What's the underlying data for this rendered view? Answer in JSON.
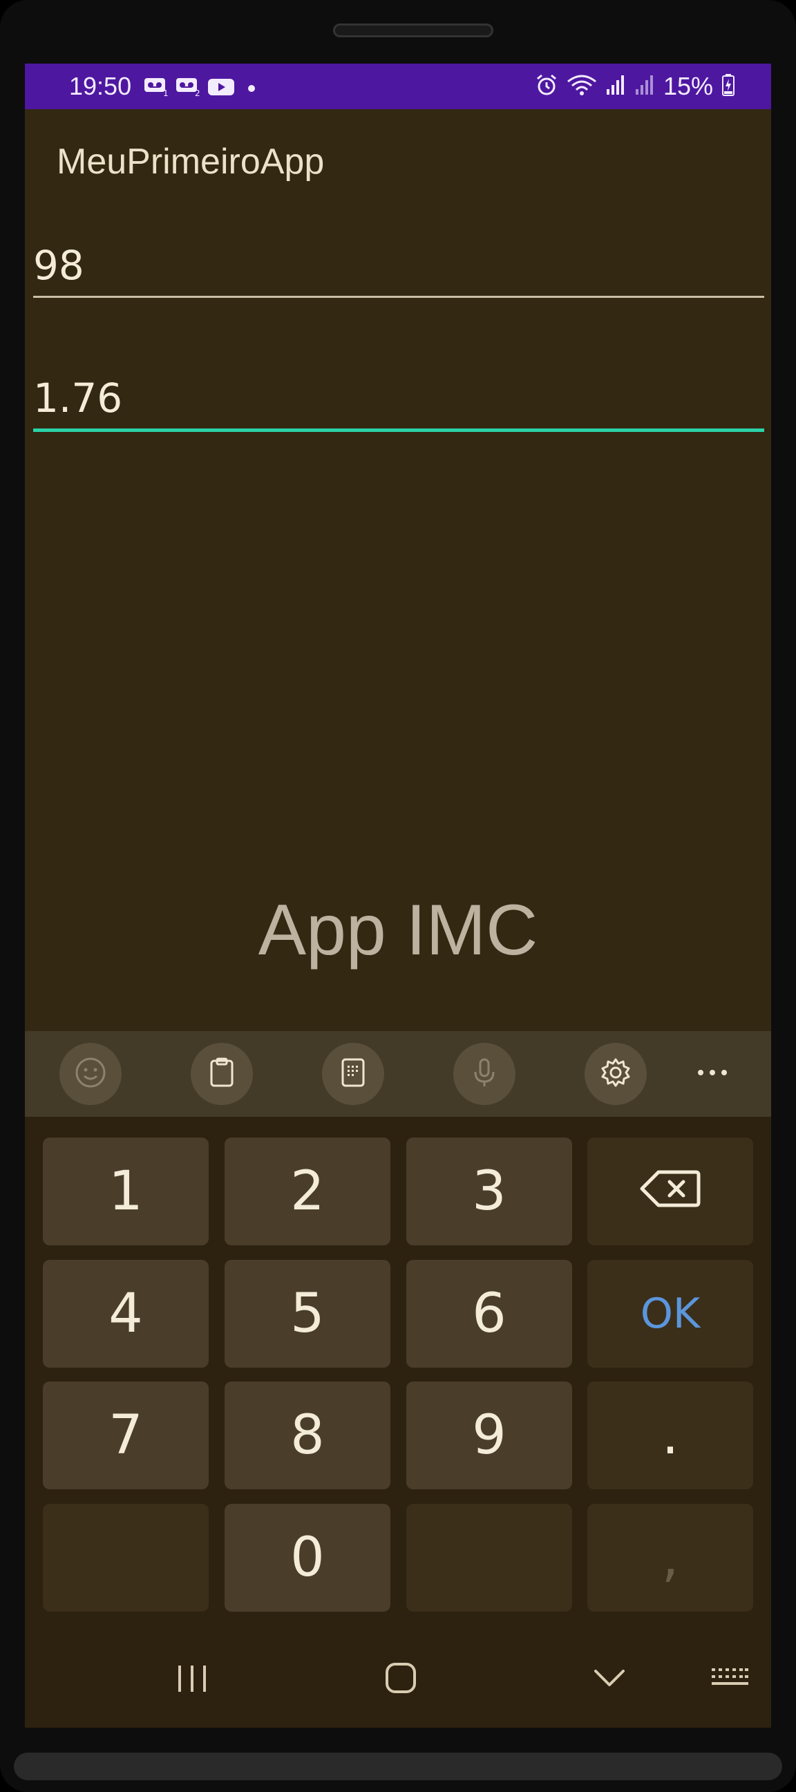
{
  "status_bar": {
    "time": "19:50",
    "battery_percent": "15%",
    "left_icons": [
      "voicemail-1-icon",
      "voicemail-2-icon",
      "youtube-icon",
      "dot-icon"
    ],
    "right_icons": [
      "alarm-icon",
      "wifi-icon",
      "signal-1-icon",
      "signal-2-icon",
      "battery-charging-icon"
    ]
  },
  "app": {
    "title": "MeuPrimeiroApp",
    "label": "App IMC"
  },
  "fields": {
    "weight": {
      "value": "98"
    },
    "height": {
      "value": "1.76",
      "focused": true
    }
  },
  "keyboard": {
    "toolbar": [
      "emoji-icon",
      "clipboard-icon",
      "numpad-icon",
      "microphone-icon",
      "settings-icon",
      "more-icon"
    ],
    "keys": {
      "k1": "1",
      "k2": "2",
      "k3": "3",
      "k4": "4",
      "k5": "5",
      "k6": "6",
      "k7": "7",
      "k8": "8",
      "k9": "9",
      "k0": "0",
      "ok": "OK",
      "dot": ".",
      "comma": ","
    }
  },
  "navbar": [
    "recent-apps-icon",
    "home-icon",
    "back-icon",
    "keyboard-icon"
  ],
  "colors": {
    "status_bar": "#4e17a0",
    "background": "#332812",
    "focus_underline": "#2bd3a8",
    "ok_key": "#5b96dd"
  }
}
